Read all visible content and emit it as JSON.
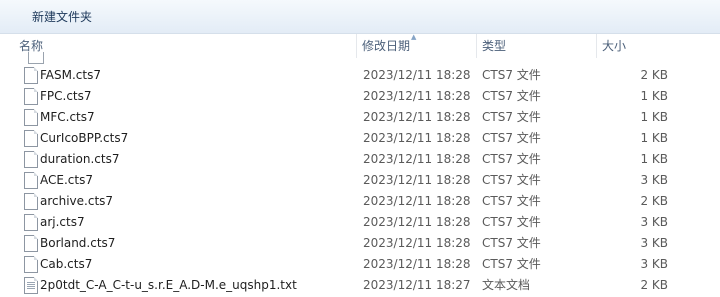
{
  "toolbar": {
    "new_folder_label": "新建文件夹"
  },
  "columns": {
    "name": "名称",
    "date": "修改日期",
    "type": "类型",
    "size": "大小"
  },
  "files": [
    {
      "name": "FASM.cts7",
      "date": "2023/12/11 18:28",
      "type": "CTS7 文件",
      "size": "2 KB",
      "icon": "file-icon"
    },
    {
      "name": "FPC.cts7",
      "date": "2023/12/11 18:28",
      "type": "CTS7 文件",
      "size": "1 KB",
      "icon": "file-icon"
    },
    {
      "name": "MFC.cts7",
      "date": "2023/12/11 18:28",
      "type": "CTS7 文件",
      "size": "1 KB",
      "icon": "file-icon"
    },
    {
      "name": "CurIcoBPP.cts7",
      "date": "2023/12/11 18:28",
      "type": "CTS7 文件",
      "size": "1 KB",
      "icon": "file-icon"
    },
    {
      "name": "duration.cts7",
      "date": "2023/12/11 18:28",
      "type": "CTS7 文件",
      "size": "1 KB",
      "icon": "file-icon"
    },
    {
      "name": "ACE.cts7",
      "date": "2023/12/11 18:28",
      "type": "CTS7 文件",
      "size": "3 KB",
      "icon": "file-icon"
    },
    {
      "name": "archive.cts7",
      "date": "2023/12/11 18:28",
      "type": "CTS7 文件",
      "size": "2 KB",
      "icon": "file-icon"
    },
    {
      "name": "arj.cts7",
      "date": "2023/12/11 18:28",
      "type": "CTS7 文件",
      "size": "3 KB",
      "icon": "file-icon"
    },
    {
      "name": "Borland.cts7",
      "date": "2023/12/11 18:28",
      "type": "CTS7 文件",
      "size": "3 KB",
      "icon": "file-icon"
    },
    {
      "name": "Cab.cts7",
      "date": "2023/12/11 18:28",
      "type": "CTS7 文件",
      "size": "3 KB",
      "icon": "file-icon"
    },
    {
      "name": "2p0tdt_C-A_C-t-u_s.r.E_A.D-M.e_uqshp1.txt",
      "date": "2023/12/11 18:27",
      "type": "文本文档",
      "size": "2 KB",
      "icon": "text-file-icon"
    }
  ]
}
